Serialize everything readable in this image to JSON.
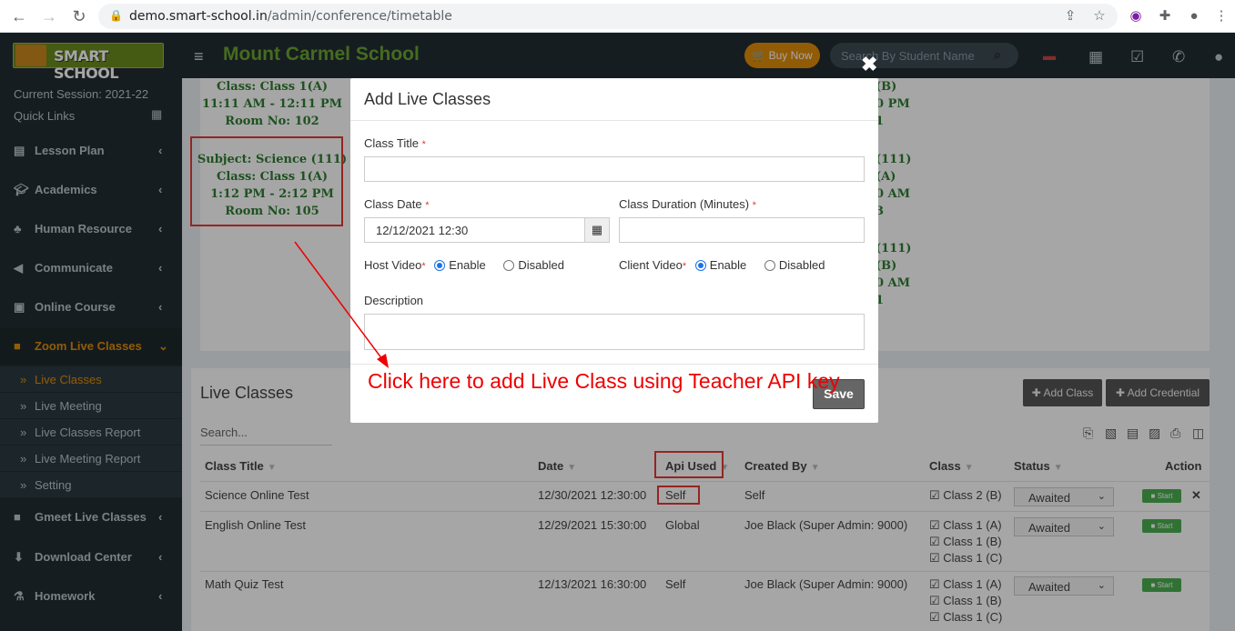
{
  "browser": {
    "url_host": "demo.smart-school.in",
    "url_path": "/admin/conference/timetable"
  },
  "header": {
    "logo_text": "SMART SCHOOL",
    "school_name": "Mount Carmel School",
    "buy_now": "Buy Now",
    "search_placeholder": "Search By Student Name"
  },
  "sidebar": {
    "session": "Current Session: 2021-22",
    "quick_links": "Quick Links",
    "menus": [
      {
        "label": "Lesson Plan",
        "icon": "list-icon"
      },
      {
        "label": "Academics",
        "icon": "graduation-cap-icon"
      },
      {
        "label": "Human Resource",
        "icon": "sitemap-icon"
      },
      {
        "label": "Communicate",
        "icon": "bullhorn-icon"
      },
      {
        "label": "Online Course",
        "icon": "file-icon"
      },
      {
        "label": "Zoom Live Classes",
        "icon": "video-icon"
      },
      {
        "label": "Gmeet Live Classes",
        "icon": "video-icon"
      },
      {
        "label": "Download Center",
        "icon": "download-icon"
      },
      {
        "label": "Homework",
        "icon": "flask-icon"
      }
    ],
    "submenu": [
      "Live Classes",
      "Live Meeting",
      "Live Classes Report",
      "Live Meeting Report",
      "Setting"
    ]
  },
  "timetable": {
    "card1": [
      "Class: Class 1(A)",
      "11:11 AM - 12:11 PM",
      "Room No: 102"
    ],
    "card2": [
      "Subject: Science (111)",
      "Class: Class 1(A)",
      "1:12 PM - 2:12 PM",
      "Room No: 105"
    ],
    "right1": [
      "(B)",
      "0 PM",
      "1"
    ],
    "right2": [
      "(111)",
      "(A)",
      "0 AM",
      "3"
    ],
    "right3": [
      "(111)",
      "(B)",
      "0 AM",
      "1"
    ]
  },
  "live_classes": {
    "title": "Live Classes",
    "add_class": "Add Class",
    "add_credential": "Add Credential",
    "search_placeholder": "Search...",
    "columns": [
      "Class Title",
      "Date",
      "Api Used",
      "Created By",
      "Class",
      "Status",
      "Action"
    ],
    "rows": [
      {
        "title": "Science Online Test",
        "date": "12/30/2021 12:30:00",
        "api": "Self",
        "created_by": "Self",
        "classes": [
          "Class 2 (B)"
        ],
        "status": "Awaited",
        "start": "Start"
      },
      {
        "title": "English Online Test",
        "date": "12/29/2021 15:30:00",
        "api": "Global",
        "created_by": "Joe Black (Super Admin: 9000)",
        "classes": [
          "Class 1 (A)",
          "Class 1 (B)",
          "Class 1 (C)"
        ],
        "status": "Awaited",
        "start": "Start"
      },
      {
        "title": "Math Quiz Test",
        "date": "12/13/2021 16:30:00",
        "api": "Self",
        "created_by": "Joe Black (Super Admin: 9000)",
        "classes": [
          "Class 1 (A)",
          "Class 1 (B)",
          "Class 1 (C)"
        ],
        "status": "Awaited",
        "start": "Start"
      }
    ]
  },
  "modal": {
    "title": "Add Live Classes",
    "class_title_label": "Class Title",
    "class_date_label": "Class Date",
    "class_date_value": "12/12/2021 12:30",
    "duration_label": "Class Duration (Minutes)",
    "host_video_label": "Host Video",
    "client_video_label": "Client Video",
    "enable": "Enable",
    "disabled": "Disabled",
    "description_label": "Description",
    "save": "Save"
  },
  "annotation": "Click here to add Live Class using Teacher API key"
}
